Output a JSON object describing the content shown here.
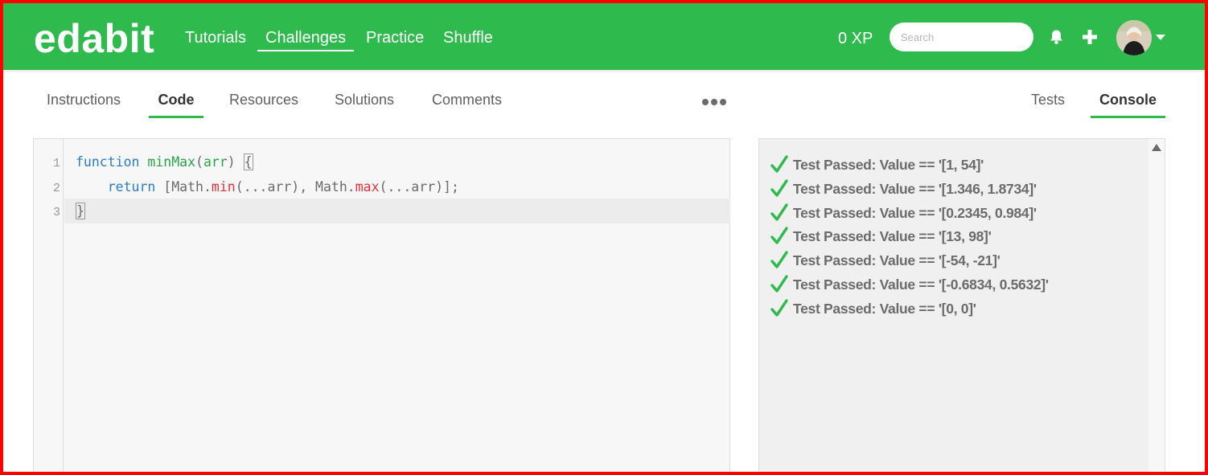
{
  "header": {
    "logo": "edabit",
    "nav": [
      "Tutorials",
      "Challenges",
      "Practice",
      "Shuffle"
    ],
    "active_nav": "Challenges",
    "xp": "0 XP",
    "search_placeholder": "Search",
    "icons": [
      "bell-icon",
      "plus-icon",
      "avatar",
      "chevron-down-icon"
    ],
    "brand_color": "#2fba4d"
  },
  "tabs": {
    "left": [
      "Instructions",
      "Code",
      "Resources",
      "Solutions",
      "Comments"
    ],
    "active_left": "Code",
    "more_icon": "ellipsis-icon",
    "right": [
      "Tests",
      "Console"
    ],
    "active_right": "Console"
  },
  "editor": {
    "line_numbers": [
      "1",
      "2",
      "3"
    ],
    "lines": [
      {
        "kw": "function",
        "fn": "minMax",
        "open": "(",
        "arg": "arr",
        "close": ") ",
        "brace": "{"
      },
      {
        "indent": "    ",
        "kw": "return",
        "p1": " [Math.",
        "m1": "min",
        "p2": "(...arr), Math.",
        "m2": "max",
        "p3": "(...arr)];"
      },
      {
        "brace": "}"
      }
    ]
  },
  "console": {
    "status_color": "#2fba4d",
    "results": [
      "Test Passed: Value == '[1, 54]'",
      "Test Passed: Value == '[1.346, 1.8734]'",
      "Test Passed: Value == '[0.2345, 0.984]'",
      "Test Passed: Value == '[13, 98]'",
      "Test Passed: Value == '[-54, -21]'",
      "Test Passed: Value == '[-0.6834, 0.5632]'",
      "Test Passed: Value == '[0, 0]'"
    ]
  }
}
